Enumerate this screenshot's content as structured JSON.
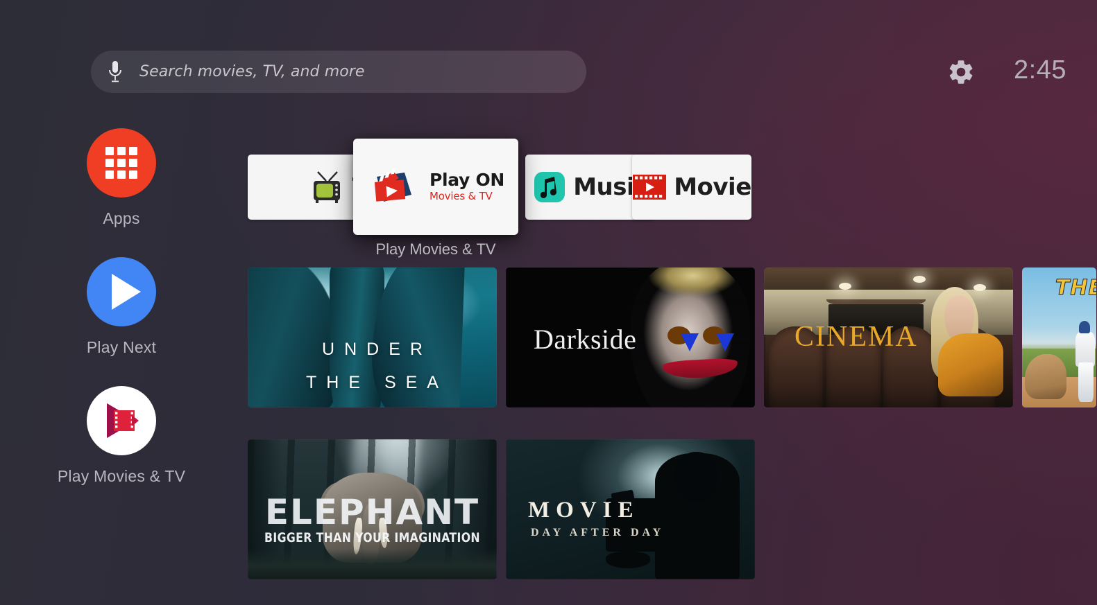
{
  "screen": {
    "name": "Android TV Home",
    "background_left": "#2d2d38",
    "background_right": "#452a3e"
  },
  "topbar": {
    "search": {
      "placeholder": "Search movies, TV, and more",
      "mic_icon": "microphone-icon",
      "value": ""
    },
    "settings_icon": "gear-icon",
    "clock": "2:45"
  },
  "sidebar": {
    "items": [
      {
        "label": "Apps",
        "icon": "apps-grid-icon",
        "color": "#ef3e23"
      },
      {
        "label": "Play Next",
        "icon": "play-triangle-icon",
        "color": "#4285f4"
      },
      {
        "label": "Play Movies & TV",
        "icon": "play-movies-tv-icon",
        "color": "#ffffff"
      }
    ]
  },
  "app_row": {
    "focused_index": 1,
    "focused_label": "Play Movies & TV",
    "cards": [
      {
        "title": "TV",
        "icon": "retro-tv-icon",
        "icon_color": "#a4c33c"
      },
      {
        "title": "Play ON",
        "subtitle": "Movies & TV",
        "icon": "clapperboard-play-icon",
        "icon_color": "#e02b20",
        "subtitle_color": "#e8211a"
      },
      {
        "title": "Music",
        "icon": "music-note-icon",
        "icon_color": "#1fc5ad"
      },
      {
        "title": "Movie",
        "icon": "film-strip-play-icon",
        "icon_color": "#d61f12"
      }
    ]
  },
  "content": {
    "rows": [
      {
        "name": "row-1",
        "tiles": [
          {
            "title": "UNDER",
            "title2": "THE SEA",
            "art": "underwater-cave",
            "clipped": false
          },
          {
            "title": "Darkside",
            "art": "joker-face-portrait",
            "clipped": false
          },
          {
            "title": "CINEMA",
            "art": "cinema-theatre-woman",
            "clipped": false
          },
          {
            "title": "THE",
            "art": "baseball-boy-with-dog",
            "clipped": true
          }
        ]
      },
      {
        "name": "row-2",
        "tiles": [
          {
            "title": "ELEPHANT",
            "subtitle": "BIGGER THAN YOUR IMAGINATION",
            "art": "elephant-in-forest",
            "clipped": false
          },
          {
            "title": "MOVIE",
            "subtitle": "DAY AFTER DAY",
            "art": "cameraman-silhouette",
            "clipped": false
          }
        ]
      }
    ]
  }
}
